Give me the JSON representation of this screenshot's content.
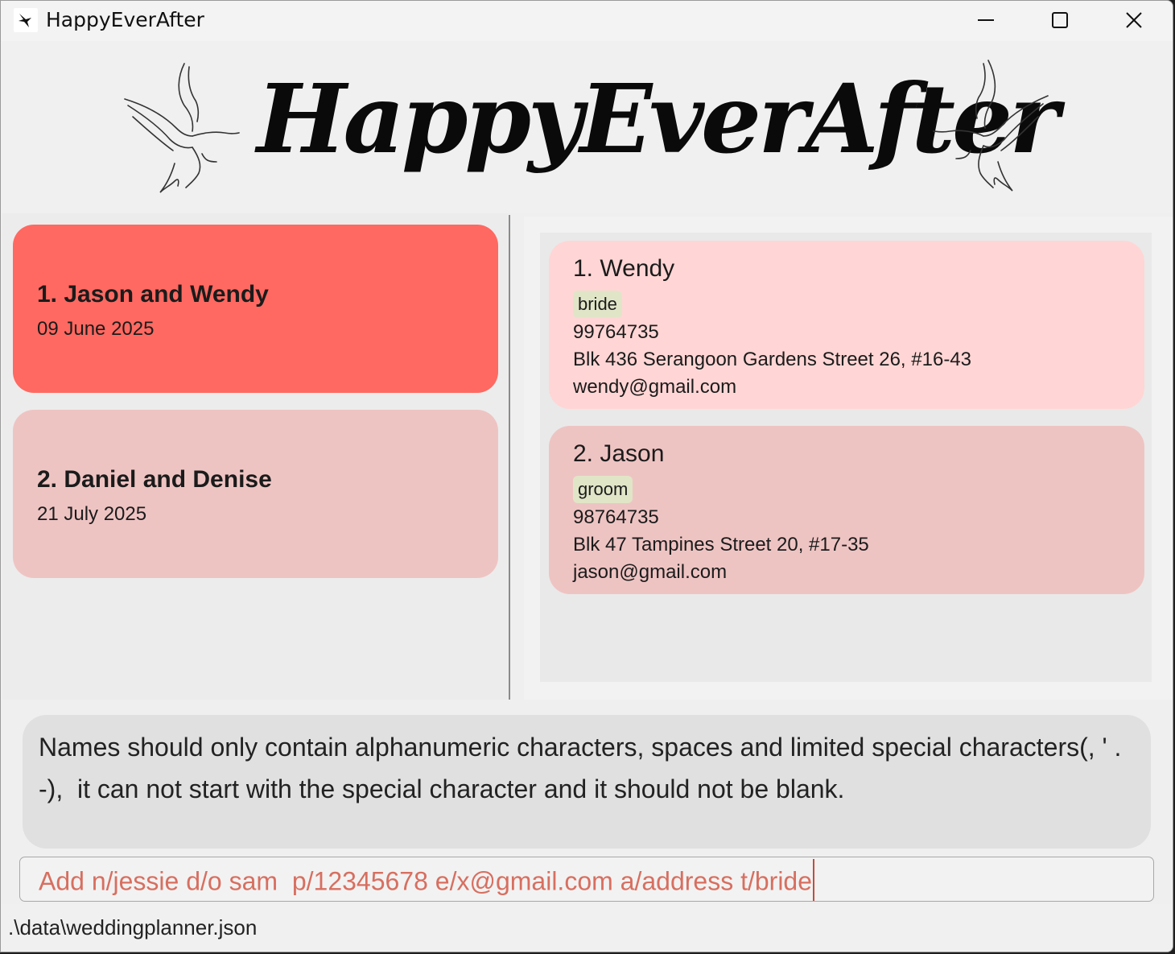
{
  "window": {
    "title": "HappyEverAfter",
    "app_icon": "bird-icon",
    "controls": {
      "minimize": "minimize-icon",
      "maximize": "maximize-icon",
      "close": "close-icon"
    }
  },
  "banner": {
    "title": "HappyEverAfter"
  },
  "weddings": [
    {
      "title": "1. Jason and Wendy",
      "date": "09 June 2025",
      "selected": true,
      "color": "#ff6961"
    },
    {
      "title": "2. Daniel and Denise",
      "date": "21 July 2025",
      "selected": false,
      "color": "#eec4c3"
    }
  ],
  "persons": [
    {
      "name": "1. Wendy",
      "tag": "bride",
      "phone": "99764735",
      "address": "Blk 436 Serangoon Gardens Street 26, #16-43",
      "email": "wendy@gmail.com",
      "color": "#ffd6d5"
    },
    {
      "name": "2. Jason",
      "tag": "groom",
      "phone": "98764735",
      "address": "Blk 47 Tampines Street 20, #17-35",
      "email": "jason@gmail.com",
      "color": "#eec4c3"
    }
  ],
  "result": {
    "message": "Names should only contain alphanumeric characters, spaces and limited special characters(, ' .\n-),  it can not start with the special character and it should not be blank."
  },
  "command": {
    "value": "Add n/jessie d/o sam  p/12345678 e/x@gmail.com a/address t/bride"
  },
  "status": {
    "file_path": ".\\data\\weddingplanner.json"
  }
}
